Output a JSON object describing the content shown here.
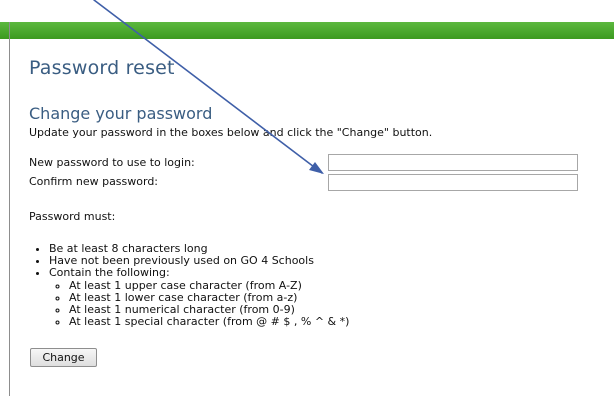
{
  "header": {
    "bar_color": "#4aa82e"
  },
  "main": {
    "title": "Password reset",
    "section_title": "Change your password",
    "instruction": "Update your password in the boxes below and click the \"Change\" button.",
    "fields": {
      "new_password": {
        "label": "New password to use to login:",
        "value": ""
      },
      "confirm_password": {
        "label": "Confirm new password:",
        "value": ""
      }
    },
    "rules_heading": "Password must:",
    "rules": [
      "Be at least 8 characters long",
      "Have not been previously used on GO 4 Schools",
      "Contain the following:"
    ],
    "sub_rules": [
      "At least 1 upper case character (from A-Z)",
      "At least 1 lower case character (from a-z)",
      "At least 1 numerical character (from 0-9)",
      "At least 1 special character (from @ # $ , % ^ & *)"
    ],
    "submit_label": "Change"
  },
  "annotation": {
    "arrow_color": "#3f5fa8"
  }
}
